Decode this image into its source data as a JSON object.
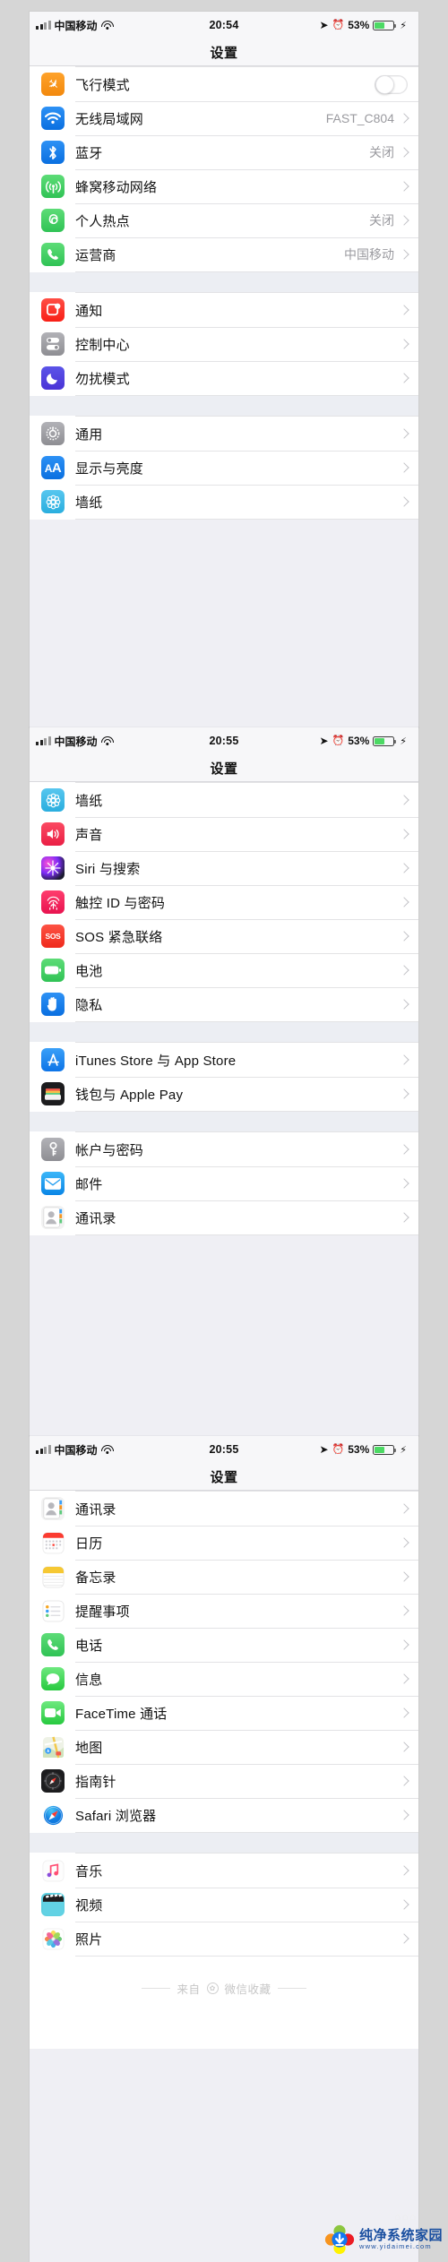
{
  "status_bar": {
    "carrier": "中国移动",
    "time_1": "20:54",
    "time_2": "20:55",
    "time_3": "20:55",
    "battery_percent": "53%",
    "battery_level": 53,
    "icons": [
      "signal-bars-icon",
      "wifi-icon",
      "location-arrow-icon",
      "alarm-clock-icon",
      "battery-icon",
      "charging-bolt-icon"
    ]
  },
  "nav": {
    "title": "设置"
  },
  "screens": [
    {
      "id": "screen-1",
      "groups": [
        {
          "rows": [
            {
              "icon": "airplane-icon",
              "label": "飞行模式",
              "control": "toggle",
              "toggle_on": false
            },
            {
              "icon": "wifi-icon",
              "label": "无线局域网",
              "value": "FAST_C804",
              "control": "chevron"
            },
            {
              "icon": "bluetooth-icon",
              "label": "蓝牙",
              "value": "关闭",
              "control": "chevron"
            },
            {
              "icon": "cellular-icon",
              "label": "蜂窝移动网络",
              "value": "",
              "control": "chevron"
            },
            {
              "icon": "hotspot-icon",
              "label": "个人热点",
              "value": "关闭",
              "control": "chevron"
            },
            {
              "icon": "phone-icon",
              "label": "运营商",
              "value": "中国移动",
              "control": "chevron"
            }
          ]
        },
        {
          "rows": [
            {
              "icon": "notifications-icon",
              "label": "通知",
              "value": "",
              "control": "chevron"
            },
            {
              "icon": "control-center-icon",
              "label": "控制中心",
              "value": "",
              "control": "chevron"
            },
            {
              "icon": "moon-icon",
              "label": "勿扰模式",
              "value": "",
              "control": "chevron"
            }
          ]
        },
        {
          "rows": [
            {
              "icon": "gear-icon",
              "label": "通用",
              "value": "",
              "control": "chevron"
            },
            {
              "icon": "display-aa-icon",
              "label": "显示与亮度",
              "value": "",
              "control": "chevron"
            },
            {
              "icon": "wallpaper-icon",
              "label": "墙纸",
              "value": "",
              "control": "chevron"
            }
          ]
        }
      ]
    },
    {
      "id": "screen-2",
      "groups": [
        {
          "rows": [
            {
              "icon": "wallpaper-icon",
              "label": "墙纸",
              "value": "",
              "control": "chevron"
            },
            {
              "icon": "sound-icon",
              "label": "声音",
              "value": "",
              "control": "chevron"
            },
            {
              "icon": "siri-icon",
              "label": "Siri 与搜索",
              "value": "",
              "control": "chevron"
            },
            {
              "icon": "touch-id-icon",
              "label": "触控 ID 与密码",
              "value": "",
              "control": "chevron"
            },
            {
              "icon": "sos-icon",
              "label": "SOS 紧急联络",
              "value": "",
              "control": "chevron"
            },
            {
              "icon": "battery-icon",
              "label": "电池",
              "value": "",
              "control": "chevron"
            },
            {
              "icon": "privacy-hand-icon",
              "label": "隐私",
              "value": "",
              "control": "chevron"
            }
          ]
        },
        {
          "rows": [
            {
              "icon": "app-store-icon",
              "label": "iTunes Store 与 App Store",
              "value": "",
              "control": "chevron"
            },
            {
              "icon": "wallet-icon",
              "label": "钱包与 Apple Pay",
              "value": "",
              "control": "chevron"
            }
          ]
        },
        {
          "rows": [
            {
              "icon": "key-icon",
              "label": "帐户与密码",
              "value": "",
              "control": "chevron"
            },
            {
              "icon": "mail-icon",
              "label": "邮件",
              "value": "",
              "control": "chevron"
            },
            {
              "icon": "contacts-icon",
              "label": "通讯录",
              "value": "",
              "control": "chevron"
            }
          ]
        }
      ]
    },
    {
      "id": "screen-3",
      "groups": [
        {
          "rows": [
            {
              "icon": "contacts-icon",
              "label": "通讯录",
              "value": "",
              "control": "chevron"
            },
            {
              "icon": "calendar-icon",
              "label": "日历",
              "value": "",
              "control": "chevron"
            },
            {
              "icon": "notes-icon",
              "label": "备忘录",
              "value": "",
              "control": "chevron"
            },
            {
              "icon": "reminders-icon",
              "label": "提醒事项",
              "value": "",
              "control": "chevron"
            },
            {
              "icon": "phone-icon",
              "label": "电话",
              "value": "",
              "control": "chevron"
            },
            {
              "icon": "messages-icon",
              "label": "信息",
              "value": "",
              "control": "chevron"
            },
            {
              "icon": "facetime-icon",
              "label": "FaceTime 通话",
              "value": "",
              "control": "chevron"
            },
            {
              "icon": "maps-icon",
              "label": "地图",
              "value": "",
              "control": "chevron"
            },
            {
              "icon": "compass-icon",
              "label": "指南针",
              "value": "",
              "control": "chevron"
            },
            {
              "icon": "safari-icon",
              "label": "Safari 浏览器",
              "value": "",
              "control": "chevron"
            }
          ]
        },
        {
          "rows": [
            {
              "icon": "music-icon",
              "label": "音乐",
              "value": "",
              "control": "chevron"
            },
            {
              "icon": "videos-icon",
              "label": "视频",
              "value": "",
              "control": "chevron"
            },
            {
              "icon": "photos-icon",
              "label": "照片",
              "value": "",
              "control": "chevron"
            }
          ]
        }
      ]
    }
  ],
  "footer": {
    "source_prefix": "来自",
    "source_name": "微信收藏"
  },
  "watermark": {
    "title": "纯净系统家园",
    "url": "www.yidaimei.com"
  },
  "colors": {
    "accent_blue": "#1278f3",
    "green": "#4cd964",
    "orange": "#f79421",
    "red": "#fc3d39",
    "list_bg": "#ffffff",
    "group_gap": "#eceef3",
    "page_bg": "#d6d6d6"
  }
}
